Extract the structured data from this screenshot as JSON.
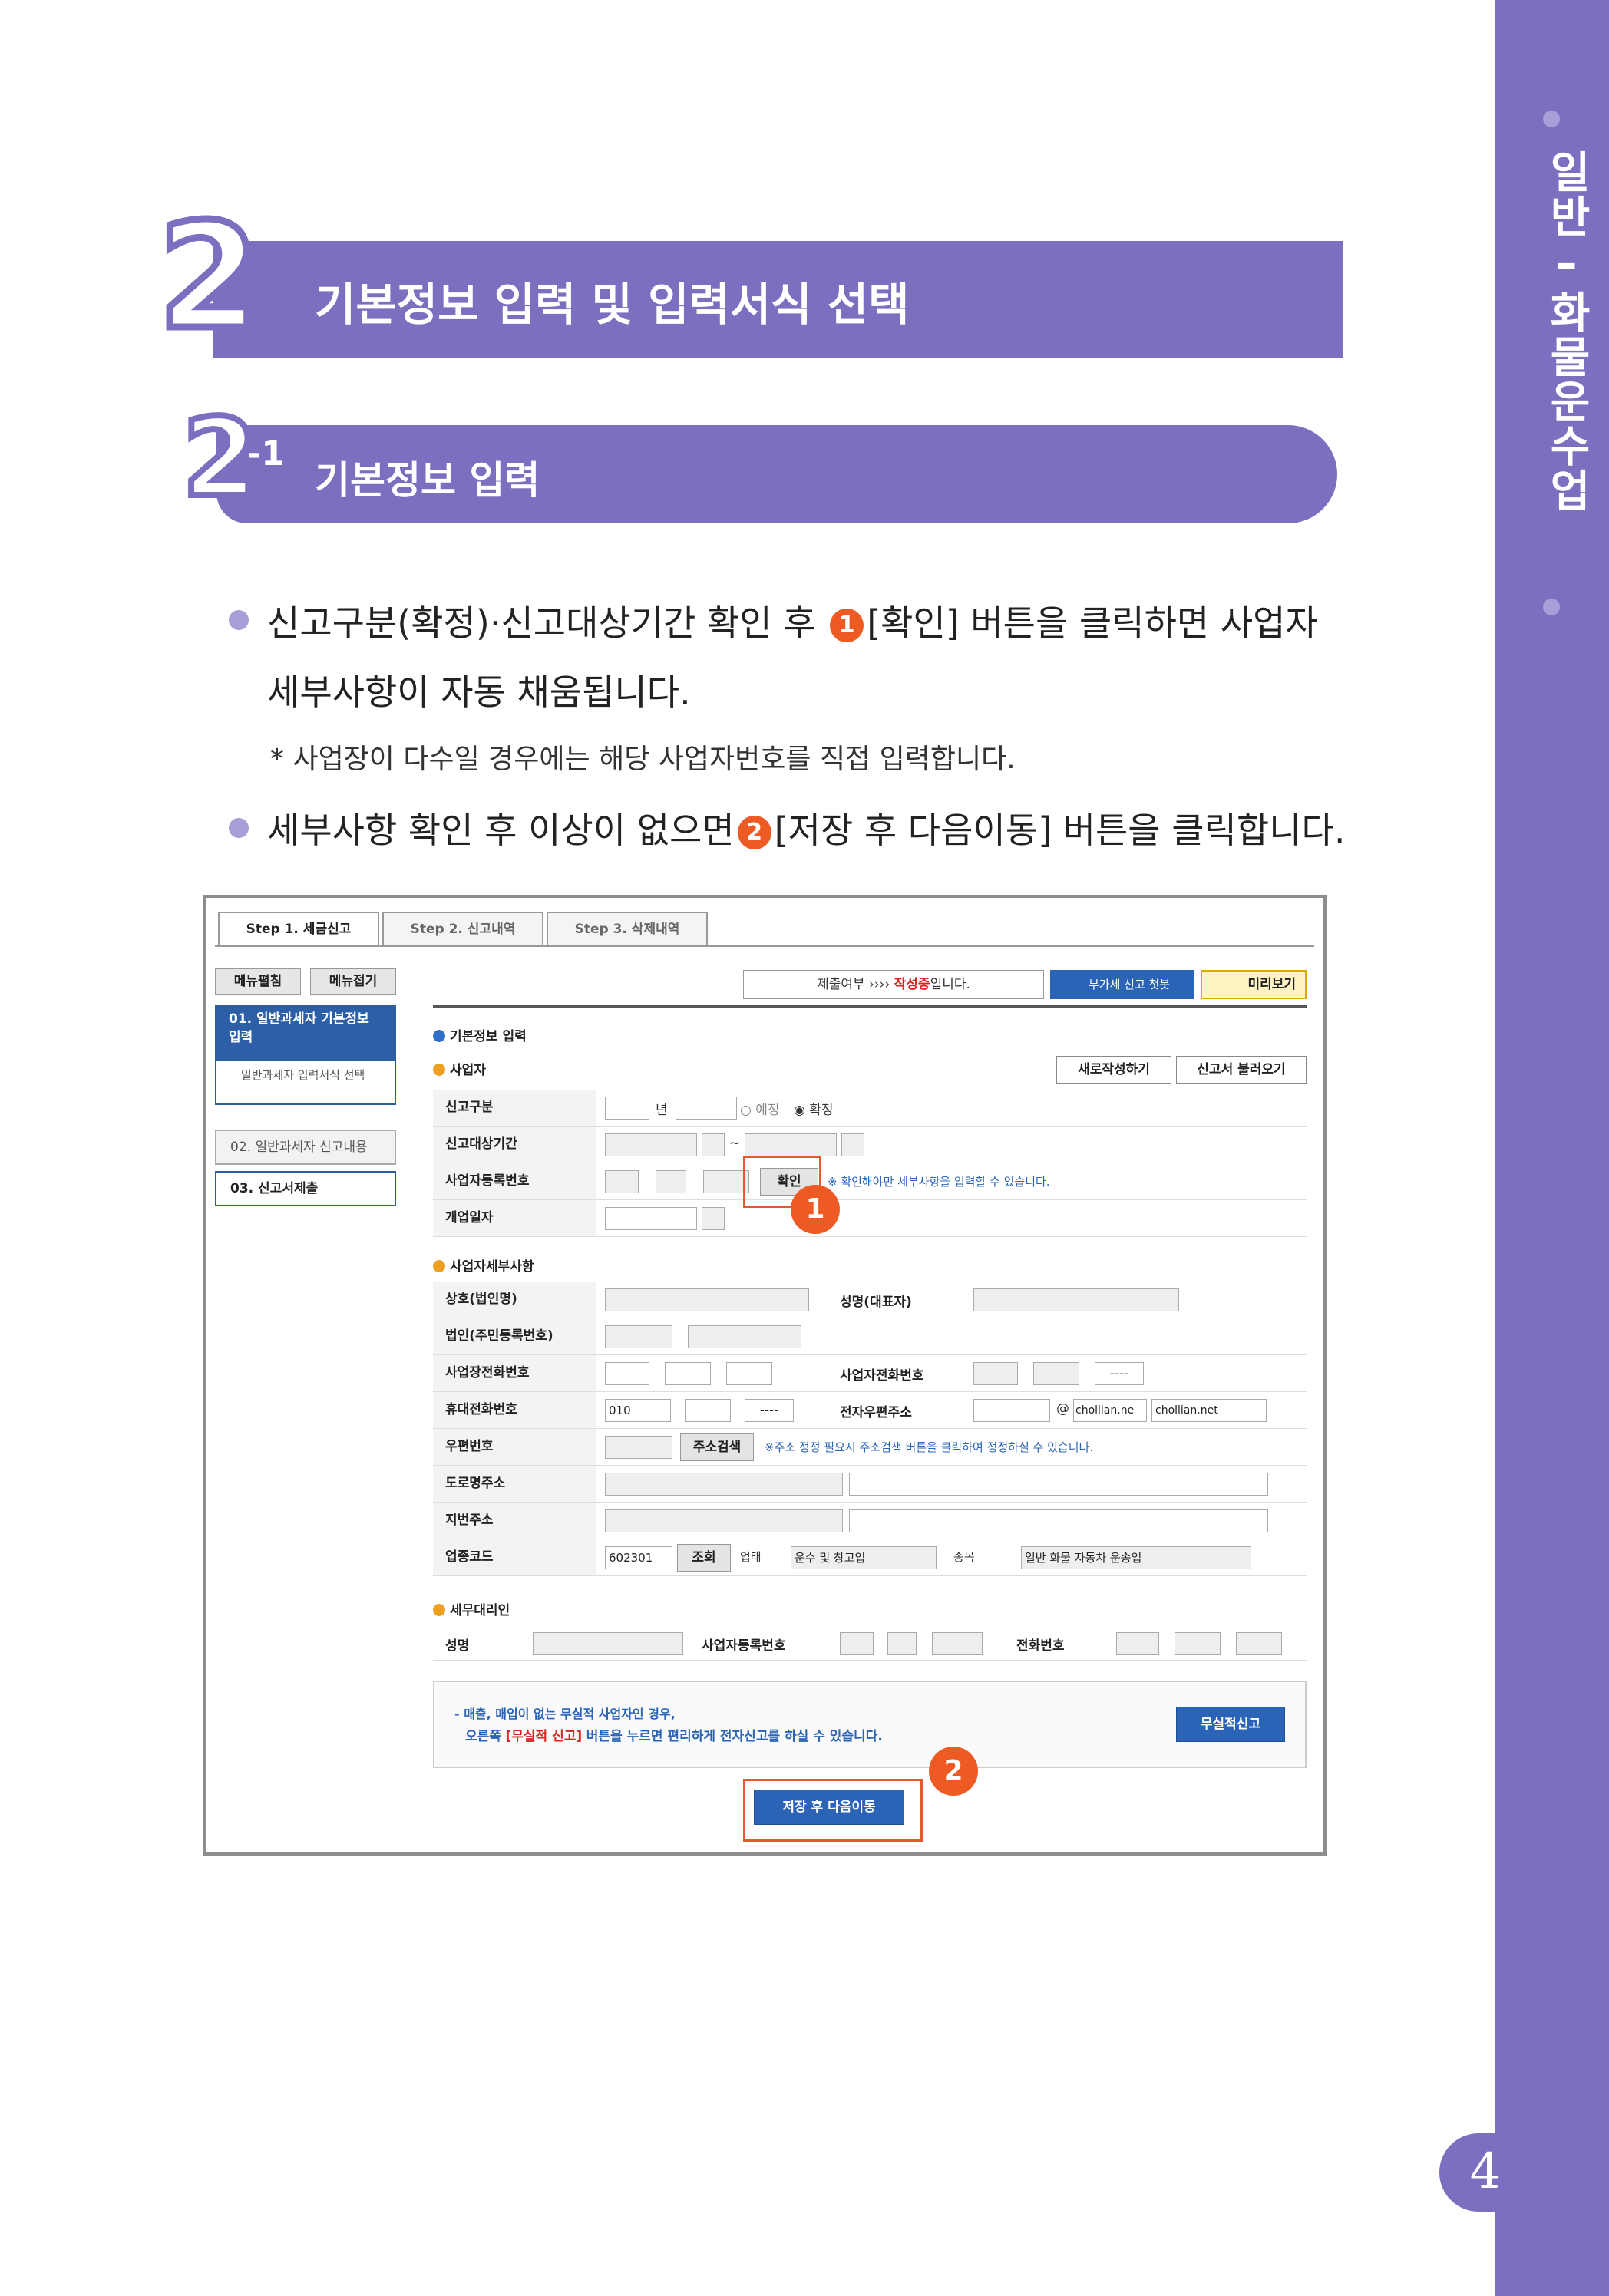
{
  "sidebar": {
    "section_title": "일반–화물운수업",
    "page_number": "4"
  },
  "heading2": {
    "number": "2",
    "title": "기본정보 입력 및 입력서식 선택"
  },
  "heading3": {
    "number": "2",
    "sub": "-1",
    "title": "기본정보 입력"
  },
  "body": {
    "b1_pre": "신고구분(확정)·신고대상기간 확인 후",
    "b1_badge": "1",
    "b1_post": "[확인] 버튼을 클릭하면 사업자",
    "b1_line2": "세부사항이 자동 채움됩니다.",
    "note": "* 사업장이 다수일 경우에는 해당 사업자번호를 직접 입력합니다.",
    "b2_pre": "세부사항 확인 후 이상이 없으면",
    "b2_badge": "2",
    "b2_post": "[저장 후 다음이동] 버튼을 클릭합니다."
  },
  "screenshot": {
    "tabs": [
      "Step 1. 세금신고",
      "Step 2. 신고내역",
      "Step 3. 삭제내역"
    ],
    "menu_buttons": [
      "메뉴펼침",
      "메뉴접기"
    ],
    "menu": {
      "item1": "01. 일반과세자 기본정보 입력",
      "item1_sub": "일반과세자 입력서식 선택",
      "item2": "02. 일반과세자 신고내용",
      "item3": "03. 신고서제출"
    },
    "status_label": "제출여부",
    "status_arrow": "›››› ",
    "status_value": "작성중",
    "status_suffix": "입니다.",
    "guide_btn": "부가세 신고 첫봇",
    "preview_btn": "미리보기",
    "section_title": "기본정보 입력",
    "sub1": "사업자",
    "new_btn": "새로작성하기",
    "load_btn": "신고서 불러오기",
    "fields": {
      "report_type": "신고구분",
      "year_unit": "년",
      "opt_prelim": "예정",
      "opt_final": "확정",
      "period": "신고대상기간",
      "period_sep": "~",
      "biz_no": "사업자등록번호",
      "confirm_btn": "확인",
      "confirm_hint": "※ 확인해야만 세부사항을 입력할 수 있습니다.",
      "open_date": "개업일자"
    },
    "sub2": "사업자세부사항",
    "detail": {
      "trade_name": "상호(법인명)",
      "rep_name": "성명(대표자)",
      "corp_no": "법인(주민등록번호)",
      "biz_phone": "사업장전화번호",
      "home_phone": "사업자전화번호",
      "mobile": "휴대전화번호",
      "mobile_prefix": "010",
      "email": "전자우편주소",
      "email_at": "@",
      "email_domain1": "chollian.ne",
      "email_domain2": "chollian.net",
      "zip": "우편번호",
      "addr_search_btn": "주소검색",
      "addr_hint": "※주소 정정 필요시 주소검색 버튼을 클릭하여 정정하실 수 있습니다.",
      "road_addr": "도로명주소",
      "lot_addr": "지번주소",
      "industry_code": "업종코드",
      "industry_code_value": "602301",
      "lookup_btn": "조회",
      "business_type": "업태",
      "business_type_value": "운수 및 창고업",
      "category": "종목",
      "category_value": "일반 화물 자동차 운송업",
      "mask": "----"
    },
    "sub3": "세무대리인",
    "agent": {
      "name": "성명",
      "biz_no": "사업자등록번호",
      "phone": "전화번호"
    },
    "notice_line1": "- 매출, 매입이 없는 무실적 사업자인 경우,",
    "notice_line2_pre": "오른쪽",
    "notice_line2_em": "[무실적 신고]",
    "notice_line2_post": "버튼을 누르면 편리하게 전자신고를 하실 수 있습니다.",
    "no_record_btn": "무실적신고",
    "save_btn": "저장 후 다음이동",
    "callout1": "1",
    "callout2": "2"
  }
}
